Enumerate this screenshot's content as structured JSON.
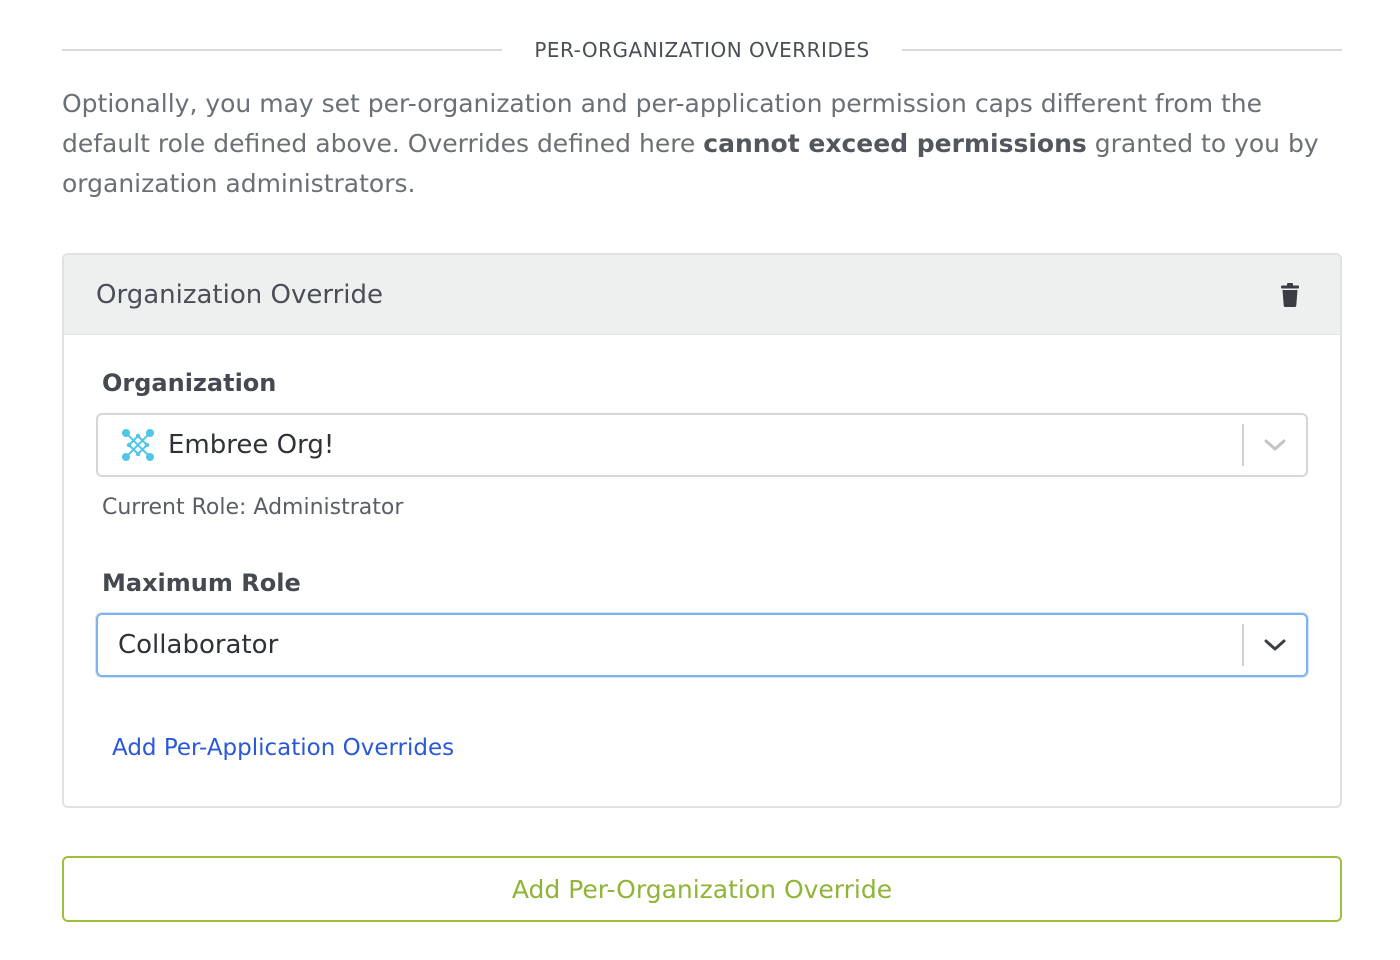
{
  "section": {
    "title": "PER-ORGANIZATION OVERRIDES"
  },
  "intro": {
    "before_bold": "Optionally, you may set per-organization and per-application permission caps different from the default role defined above. Overrides defined here ",
    "bold": "cannot exceed permissions",
    "after_bold": " granted to you by organization administrators."
  },
  "override_card": {
    "title": "Organization Override",
    "delete_icon": "trash-icon",
    "organization": {
      "label": "Organization",
      "value": "Embree Org!",
      "icon": "organization-network-icon",
      "icon_color": "#4fc6e8"
    },
    "current_role": "Current Role: Administrator",
    "maximum_role": {
      "label": "Maximum Role",
      "value": "Collaborator"
    },
    "add_app_overrides_link": "Add Per-Application Overrides"
  },
  "add_org_override_button": "Add Per-Organization Override",
  "colors": {
    "link": "#2a58d6",
    "accent_green": "#8fb536",
    "focus_border": "#7fb3ea",
    "header_bg": "#eef0f0"
  }
}
